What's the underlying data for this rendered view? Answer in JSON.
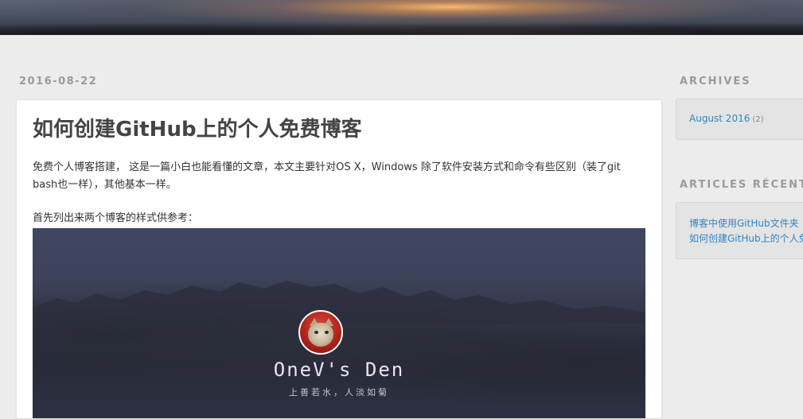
{
  "post": {
    "date": "2016-08-22",
    "title": "如何创建GitHub上的个人免费博客",
    "paragraph1": "免费个人博客搭建， 这是一篇小白也能看懂的文章，本文主要针对OS X，Windows 除了软件安装方式和命令有些区别（装了git bash也一样），其他基本一样。",
    "paragraph2": "首先列出来两个博客的样式供参考：",
    "image": {
      "site_name": "OneV's Den",
      "tagline": "上善若水，人淡如菊"
    }
  },
  "sidebar": {
    "archives": {
      "heading": "ARCHIVES",
      "items": [
        {
          "label": "August 2016",
          "count": "(2)"
        }
      ]
    },
    "recent": {
      "heading": "ARTICLES RÉCENTS",
      "items": [
        {
          "label": "博客中使用GitHub文件夹"
        },
        {
          "label": "如何创建GitHub上的个人免费博客"
        }
      ]
    }
  },
  "colors": {
    "background": "#ececec",
    "link": "#2f86c1",
    "heading_gray": "#9a9a9a",
    "title": "#444444"
  }
}
